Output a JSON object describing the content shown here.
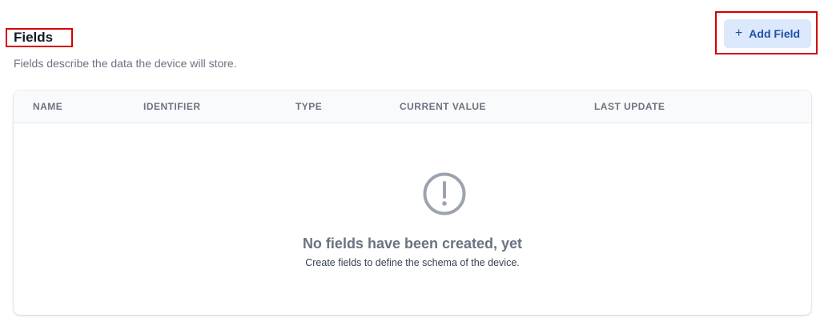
{
  "section": {
    "title": "Fields",
    "description": "Fields describe the data the device will store."
  },
  "toolbar": {
    "add_icon": "+",
    "add_label": "Add Field"
  },
  "table": {
    "columns": [
      "NAME",
      "IDENTIFIER",
      "TYPE",
      "CURRENT VALUE",
      "LAST UPDATE"
    ]
  },
  "empty_state": {
    "icon": "exclamation-circle-icon",
    "title": "No fields have been created, yet",
    "description": "Create fields to define the schema of the device."
  },
  "colors": {
    "highlight": "#d40000",
    "button_bg": "#dce8fb",
    "button_text": "#1f4fa8",
    "icon_gray": "#9ca3af"
  }
}
